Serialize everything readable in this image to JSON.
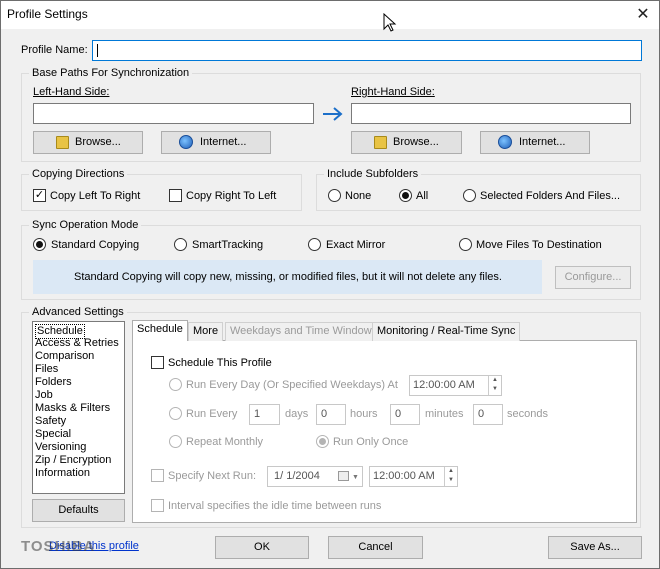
{
  "window": {
    "title": "Profile Settings"
  },
  "profile_name": {
    "label": "Profile Name:",
    "value": ""
  },
  "base_paths": {
    "legend": "Base Paths For Synchronization",
    "left_label": "Left-Hand Side:",
    "right_label": "Right-Hand Side:",
    "left_value": "",
    "right_value": "",
    "browse_label": "Browse...",
    "internet_label": "Internet..."
  },
  "copying": {
    "legend": "Copying Directions",
    "left_to_right": "Copy Left To Right",
    "right_to_left": "Copy Right To Left"
  },
  "subfolders": {
    "legend": "Include Subfolders",
    "none": "None",
    "all": "All",
    "selected": "Selected Folders And Files..."
  },
  "sync_mode": {
    "legend": "Sync Operation Mode",
    "standard": "Standard Copying",
    "smart": "SmartTracking",
    "mirror": "Exact Mirror",
    "move": "Move Files To Destination",
    "info": "Standard Copying will copy new, missing, or modified files, but it will not delete any files.",
    "configure": "Configure..."
  },
  "advanced": {
    "legend": "Advanced Settings",
    "items": [
      "Schedule",
      "Access & Retries",
      "Comparison",
      "Files",
      "Folders",
      "Job",
      "Masks & Filters",
      "Safety",
      "Special",
      "Versioning",
      "Zip / Encryption",
      "Information"
    ],
    "defaults": "Defaults"
  },
  "tabs": [
    "Schedule",
    "More",
    "Weekdays and Time Window",
    "Monitoring / Real-Time Sync"
  ],
  "schedule": {
    "schedule_this": "Schedule This Profile",
    "every_day": "Run Every Day (Or Specified Weekdays) At",
    "every_day_time": "12:00:00 AM",
    "run_every": "Run Every",
    "days_val": "1",
    "days": "days",
    "hours_val": "0",
    "hours": "hours",
    "minutes_val": "0",
    "minutes": "minutes",
    "seconds_val": "0",
    "seconds": "seconds",
    "monthly": "Repeat Monthly",
    "only_once": "Run Only Once",
    "next_run": "Specify Next Run:",
    "next_date": "1/  1/2004",
    "next_time": "12:00:00 AM",
    "interval": "Interval specifies the idle time between runs"
  },
  "footer": {
    "disable_link": "Disable this profile",
    "watermark": "TOSHIBA",
    "ok": "OK",
    "cancel": "Cancel",
    "save_as": "Save As..."
  }
}
